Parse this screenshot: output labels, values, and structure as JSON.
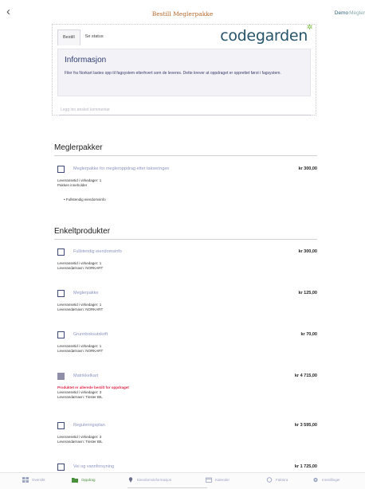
{
  "header": {
    "back_glyph": "‹",
    "title": "Bestill Meglerpakke",
    "user_first": "Demo",
    "user_second": "Megler"
  },
  "tabs": {
    "order": "Bestill",
    "status": "Se status"
  },
  "logo": {
    "text": "codegarden",
    "sprig": "✲"
  },
  "info": {
    "heading": "Informasjon",
    "text": "Filer fra Norkart lastes opp til fagsystem etterhvert som de leveres. Dette krever at oppdraget er opprettet først i fagsystem."
  },
  "comment_placeholder": "Legg inn ønsket kommentar",
  "meglerpakker": {
    "heading": "Meglerpakker",
    "items": [
      {
        "name": "Meglerpakke for megleroppdrag etter takseringen",
        "price": "kr 300,00",
        "line1": "Leveransetid i virkedager: 1",
        "line2": "Pakken inneholder",
        "bullet": "• Fullstendig eiendomsinfo"
      }
    ]
  },
  "enkelt": {
    "heading": "Enkeltprodukter",
    "items": [
      {
        "name": "Fullstendig eiendomsinfo",
        "price": "kr 300,00",
        "line1": "Leveransetid i virkedager: 1",
        "line2": "Leverandørnavn: NORKART",
        "warn": "",
        "disabled": false
      },
      {
        "name": "Meglerpakke",
        "price": "kr 125,00",
        "line1": "Leveransetid i virkedager: 1",
        "line2": "Leverandørnavn: NORKART",
        "warn": "",
        "disabled": false
      },
      {
        "name": "Grunnboksutskrift",
        "price": "kr 70,00",
        "line1": "Leveransetid i virkedager: 1",
        "line2": "Leverandørnavn: NORKART",
        "warn": "",
        "disabled": false
      },
      {
        "name": "Matrikkelkart",
        "price": "kr 4 715,00",
        "line1": "Leveransetid i virkedager: 3",
        "line2": "Leverandørnavn: Tinster BIL",
        "warn": "Produktet er allerede bestilt for oppdraget",
        "disabled": true
      },
      {
        "name": "Reguleringsplan",
        "price": "kr 3 595,00",
        "line1": "Leveransetid i virkedager: 3",
        "line2": "Leverandørnavn: Tinster BIL",
        "warn": "",
        "disabled": false
      },
      {
        "name": "Vei og vannforsyning",
        "price": "kr 1 725,00",
        "line1": "",
        "line2": "",
        "warn": "",
        "disabled": false
      }
    ]
  },
  "bottom_nav": [
    {
      "label": "Oversikt",
      "icon": "grid-icon"
    },
    {
      "label": "Oppdrag",
      "icon": "folder-icon"
    },
    {
      "label": "Eiendomsinformasjon",
      "icon": "pin-icon"
    },
    {
      "label": "Kalender",
      "icon": "calendar-icon"
    },
    {
      "label": "Faktura",
      "icon": "refresh-icon"
    },
    {
      "label": "Innstillinger",
      "icon": "gear-icon"
    }
  ]
}
